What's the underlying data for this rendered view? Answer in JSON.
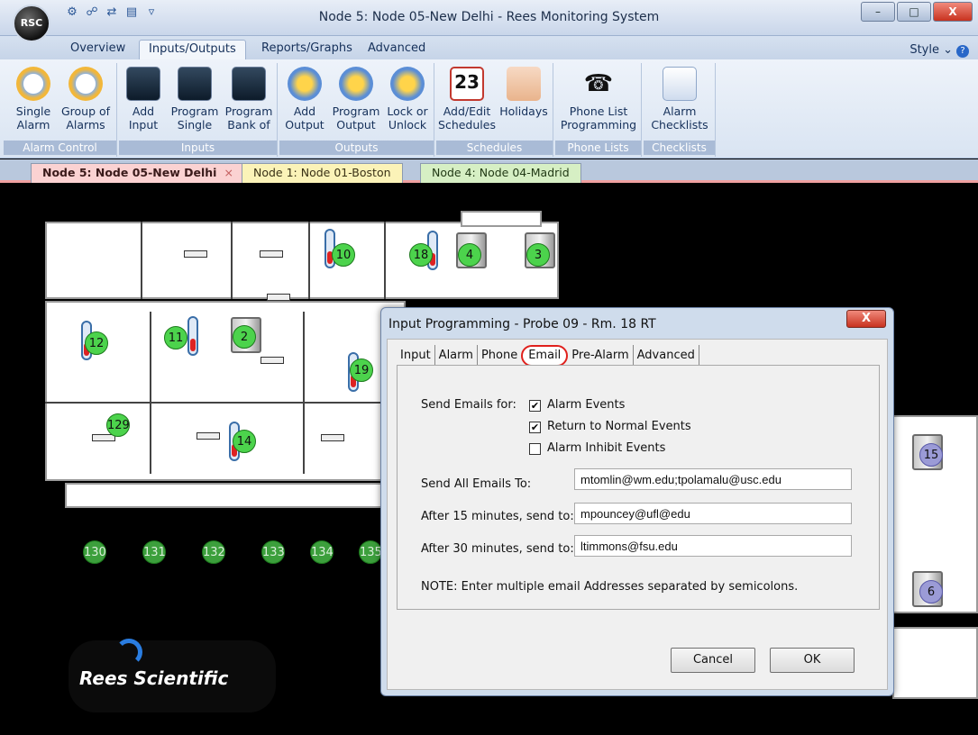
{
  "window": {
    "orb_label": "RSC",
    "title": "Node 5: Node 05-New Delhi - Rees Monitoring System",
    "minimize": "–",
    "maximize": "□",
    "close": "X"
  },
  "ribbon_tabs": [
    {
      "label": "Overview"
    },
    {
      "label": "Inputs/Outputs"
    },
    {
      "label": "Reports/Graphs"
    },
    {
      "label": "Advanced"
    }
  ],
  "style_menu": "Style ⌄",
  "help_glyph": "?",
  "ribbon": {
    "groups": [
      {
        "label": "Alarm Control",
        "buttons": [
          {
            "line1": "Single",
            "line2": "Alarm",
            "icon": "alarm-clock-icon"
          },
          {
            "line1": "Group of",
            "line2": "Alarms",
            "icon": "alarm-clocks-icon"
          }
        ]
      },
      {
        "label": "Inputs",
        "buttons": [
          {
            "line1": "Add",
            "line2": "Input",
            "icon": "add-input-icon"
          },
          {
            "line1": "Program",
            "line2": "Single",
            "icon": "program-input-icon"
          },
          {
            "line1": "Program",
            "line2": "Bank of",
            "icon": "program-bank-icon"
          }
        ]
      },
      {
        "label": "Outputs",
        "buttons": [
          {
            "line1": "Add",
            "line2": "Output",
            "icon": "add-output-icon"
          },
          {
            "line1": "Program",
            "line2": "Output",
            "icon": "program-output-icon"
          },
          {
            "line1": "Lock or",
            "line2": "Unlock",
            "icon": "lock-output-icon"
          }
        ]
      },
      {
        "label": "Schedules",
        "buttons": [
          {
            "line1": "Add/Edit",
            "line2": "Schedules",
            "icon": "calendar-icon",
            "badge": "23"
          },
          {
            "line1": "Holidays",
            "line2": "",
            "icon": "house-icon"
          }
        ]
      },
      {
        "label": "Phone Lists",
        "buttons": [
          {
            "line1": "Phone List",
            "line2": "Programming",
            "icon": "phone-icon"
          }
        ]
      },
      {
        "label": "Checklists",
        "buttons": [
          {
            "line1": "Alarm",
            "line2": "Checklists",
            "icon": "checklist-icon"
          }
        ]
      }
    ]
  },
  "doc_tabs": [
    {
      "label": "Node 5: Node 05-New Delhi",
      "close": "×"
    },
    {
      "label": "Node 1: Node 01-Boston"
    },
    {
      "label": "Node 4: Node 04-Madrid"
    }
  ],
  "probes": [
    "10",
    "18",
    "4",
    "3",
    "12",
    "11",
    "2",
    "19",
    "129",
    "14",
    "15",
    "6",
    "130",
    "131",
    "132",
    "133",
    "134",
    "135"
  ],
  "logo": {
    "text": "Rees Scientific"
  },
  "dialog": {
    "title": "Input Programming - Probe 09 - Rm. 18 RT",
    "close": "X",
    "tabs": [
      "Input",
      "Alarm",
      "Phone",
      "Email",
      "Pre-Alarm",
      "Advanced"
    ],
    "selected_tab": "Email",
    "send_emails_for_label": "Send Emails for:",
    "checkboxes": [
      {
        "label": "Alarm Events",
        "checked": true
      },
      {
        "label": "Return to Normal Events",
        "checked": true
      },
      {
        "label": "Alarm Inhibit Events",
        "checked": false
      }
    ],
    "fields": [
      {
        "label": "Send All Emails To:",
        "value": "mtomlin@wm.edu;tpolamalu@usc.edu"
      },
      {
        "label": "After 15 minutes, send to:",
        "value": "mpouncey@ufl@edu"
      },
      {
        "label": "After 30 minutes, send to:",
        "value": "ltimmons@fsu.edu"
      }
    ],
    "note": "NOTE: Enter multiple email Addresses separated by semicolons.",
    "cancel_label": "Cancel",
    "ok_label": "OK"
  }
}
